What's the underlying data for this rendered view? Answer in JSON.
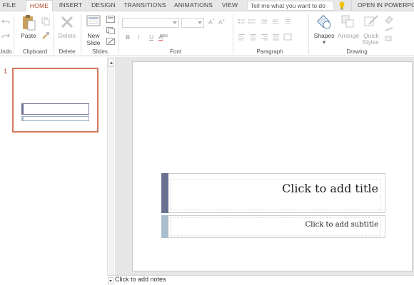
{
  "tabs": [
    "FILE",
    "HOME",
    "INSERT",
    "DESIGN",
    "TRANSITIONS",
    "ANIMATIONS",
    "VIEW"
  ],
  "active_tab": "HOME",
  "tell_me": {
    "placeholder": "Tell me what you want to do"
  },
  "open_in": "OPEN IN POWERPOINT",
  "ribbon": {
    "groups": {
      "undo": "Undo",
      "clipboard": "Clipboard",
      "delete": "Delete",
      "slides": "Slides",
      "font": "Font",
      "paragraph": "Paragraph",
      "drawing": "Drawing"
    },
    "buttons": {
      "paste": "Paste",
      "delete": "Delete",
      "new_slide_1": "New",
      "new_slide_2": "Slide",
      "shapes": "Shapes",
      "arrange": "Arrange",
      "quick_styles_1": "Quick",
      "quick_styles_2": "Styles"
    },
    "font_buttons": {
      "bold": "B",
      "italic": "I",
      "underline": "U",
      "strike": "abc",
      "font_color": "A"
    }
  },
  "thumbnails": [
    {
      "number": "1"
    }
  ],
  "slide": {
    "title_placeholder": "Click to add title",
    "subtitle_placeholder": "Click to add subtitle"
  },
  "notes": {
    "placeholder": "Click to add notes"
  },
  "colors": {
    "accent": "#b7472a",
    "title_bar": "#6a7292",
    "subtitle_bar": "#a9bfcd"
  }
}
